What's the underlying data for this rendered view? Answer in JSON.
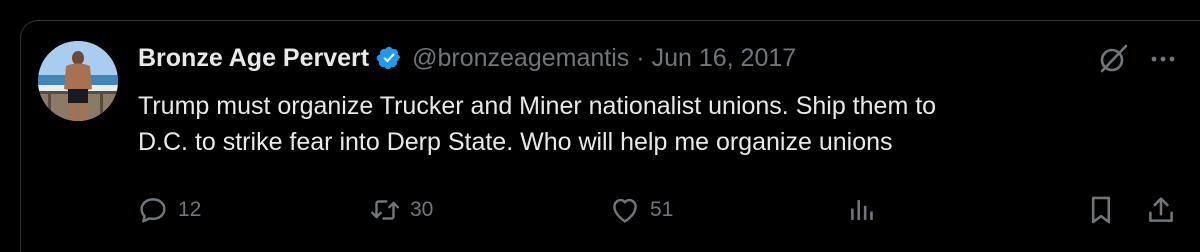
{
  "tweet": {
    "author_name": "Bronze Age Pervert",
    "handle": "@bronzeagemantis",
    "separator": "·",
    "date": "Jun 16, 2017",
    "text_lines": [
      "Trump must organize Trucker and Miner nationalist unions. Ship them to",
      "D.C. to strike fear into Derp State. Who will help me organize unions"
    ]
  },
  "actions": {
    "reply_count": "12",
    "retweet_count": "30",
    "like_count": "51"
  },
  "icons": {
    "verified": "verified-badge-icon",
    "grok": "grok-icon",
    "more": "more-icon",
    "reply": "reply-icon",
    "retweet": "retweet-icon",
    "like": "heart-icon",
    "views": "views-icon",
    "bookmark": "bookmark-icon",
    "share": "share-icon"
  },
  "colors": {
    "background": "#000000",
    "text_primary": "#e7e9ea",
    "text_secondary": "#71767b",
    "verified_blue": "#1d9bf0",
    "border": "#2f3336"
  }
}
